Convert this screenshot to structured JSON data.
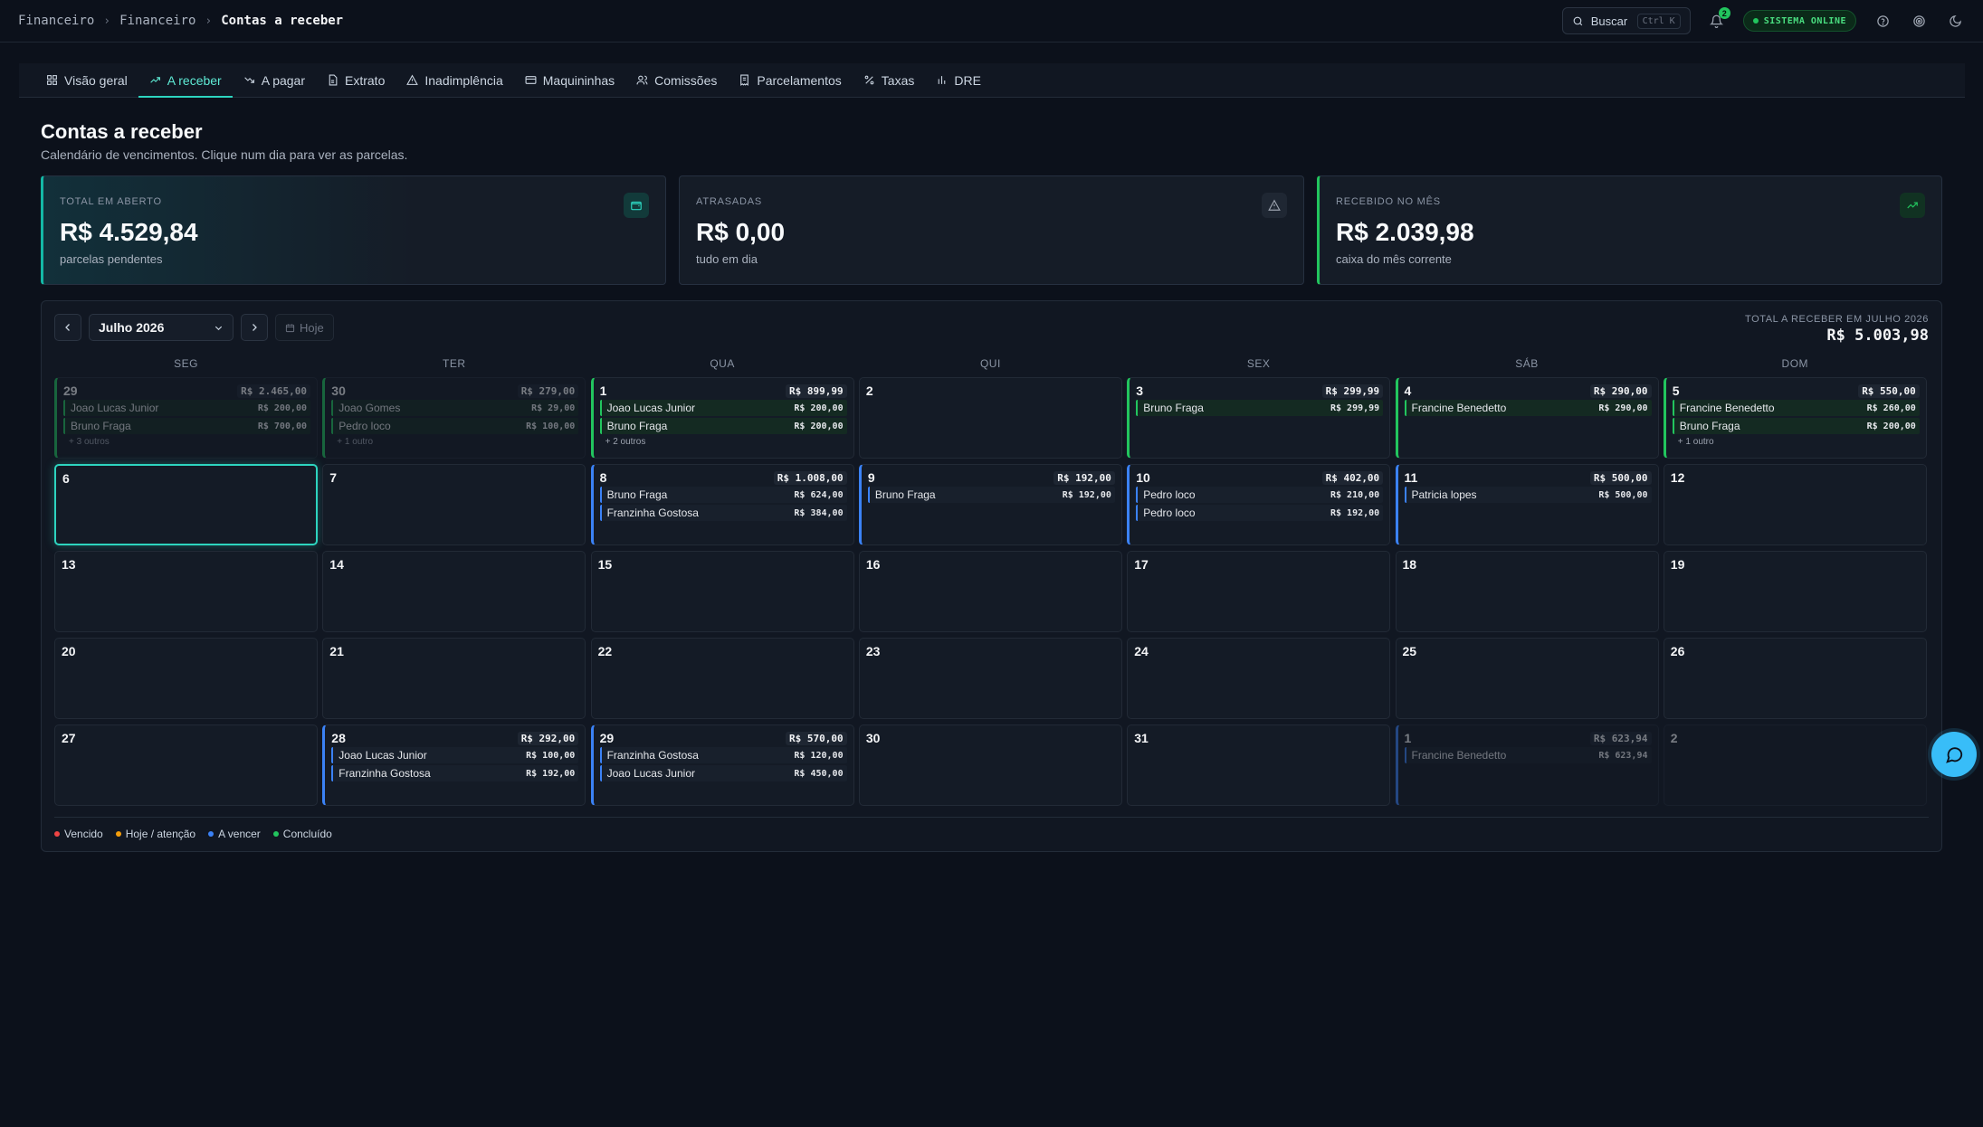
{
  "breadcrumb": [
    "Financeiro",
    "Financeiro",
    "Contas a receber"
  ],
  "header": {
    "search_label": "Buscar",
    "search_kbd": "Ctrl K",
    "notifications_count": "2",
    "status": "SISTEMA ONLINE"
  },
  "tabs": [
    {
      "label": "Visão geral",
      "icon": "grid-icon"
    },
    {
      "label": "A receber",
      "icon": "trending-up-icon",
      "active": true
    },
    {
      "label": "A pagar",
      "icon": "trending-down-icon"
    },
    {
      "label": "Extrato",
      "icon": "file-icon"
    },
    {
      "label": "Inadimplência",
      "icon": "warning-icon"
    },
    {
      "label": "Maquininhas",
      "icon": "card-icon"
    },
    {
      "label": "Comissões",
      "icon": "users-icon"
    },
    {
      "label": "Parcelamentos",
      "icon": "receipt-icon"
    },
    {
      "label": "Taxas",
      "icon": "percent-icon"
    },
    {
      "label": "DRE",
      "icon": "bar-chart-icon"
    }
  ],
  "page": {
    "title": "Contas a receber",
    "subtitle": "Calendário de vencimentos. Clique num dia para ver as parcelas."
  },
  "cards": [
    {
      "label": "TOTAL EM ABERTO",
      "value": "R$ 4.529,84",
      "sub": "parcelas pendentes",
      "icon": "wallet-icon",
      "accent": "#14b8a6"
    },
    {
      "label": "ATRASADAS",
      "value": "R$ 0,00",
      "sub": "tudo em dia",
      "icon": "warning-icon",
      "accent": "#374151"
    },
    {
      "label": "RECEBIDO NO MÊS",
      "value": "R$ 2.039,98",
      "sub": "caixa do mês corrente",
      "icon": "trending-up-icon",
      "accent": "#22c55e"
    }
  ],
  "calendar": {
    "month": "Julho 2026",
    "today_label": "Hoje",
    "total_label": "TOTAL A RECEBER EM JULHO 2026",
    "total_value": "R$ 5.003,98",
    "weekdays": [
      "SEG",
      "TER",
      "QUA",
      "QUI",
      "SEX",
      "SÁB",
      "DOM"
    ],
    "days": [
      {
        "n": "29",
        "other": true,
        "status": "green",
        "sum": "R$ 2.465,00",
        "entries": [
          {
            "name": "Joao Lucas Junior",
            "amt": "R$ 200,00",
            "g": true
          },
          {
            "name": "Bruno Fraga",
            "amt": "R$ 700,00",
            "g": true
          }
        ],
        "more": "+ 3 outros"
      },
      {
        "n": "30",
        "other": true,
        "status": "green",
        "sum": "R$ 279,00",
        "entries": [
          {
            "name": "Joao Gomes",
            "amt": "R$ 29,00",
            "g": true
          },
          {
            "name": "Pedro loco",
            "amt": "R$ 100,00",
            "g": true
          }
        ],
        "more": "+ 1 outro"
      },
      {
        "n": "1",
        "status": "green",
        "sum": "R$ 899,99",
        "entries": [
          {
            "name": "Joao Lucas Junior",
            "amt": "R$ 200,00",
            "g": true
          },
          {
            "name": "Bruno Fraga",
            "amt": "R$ 200,00",
            "g": true
          }
        ],
        "more": "+ 2 outros"
      },
      {
        "n": "2",
        "entries": []
      },
      {
        "n": "3",
        "status": "green",
        "sum": "R$ 299,99",
        "entries": [
          {
            "name": "Bruno Fraga",
            "amt": "R$ 299,99",
            "g": true
          }
        ]
      },
      {
        "n": "4",
        "status": "green",
        "sum": "R$ 290,00",
        "entries": [
          {
            "name": "Francine Benedetto",
            "amt": "R$ 290,00",
            "g": true
          }
        ]
      },
      {
        "n": "5",
        "status": "green",
        "sum": "R$ 550,00",
        "entries": [
          {
            "name": "Francine Benedetto",
            "amt": "R$ 260,00",
            "g": true
          },
          {
            "name": "Bruno Fraga",
            "amt": "R$ 200,00",
            "g": true
          }
        ],
        "more": "+ 1 outro"
      },
      {
        "n": "6",
        "today": true,
        "entries": []
      },
      {
        "n": "7",
        "entries": []
      },
      {
        "n": "8",
        "status": "blue",
        "sum": "R$ 1.008,00",
        "entries": [
          {
            "name": "Bruno Fraga",
            "amt": "R$ 624,00"
          },
          {
            "name": "Franzinha Gostosa",
            "amt": "R$ 384,00"
          }
        ]
      },
      {
        "n": "9",
        "status": "blue",
        "sum": "R$ 192,00",
        "entries": [
          {
            "name": "Bruno Fraga",
            "amt": "R$ 192,00"
          }
        ]
      },
      {
        "n": "10",
        "status": "blue",
        "sum": "R$ 402,00",
        "entries": [
          {
            "name": "Pedro loco",
            "amt": "R$ 210,00"
          },
          {
            "name": "Pedro loco",
            "amt": "R$ 192,00"
          }
        ]
      },
      {
        "n": "11",
        "status": "blue",
        "sum": "R$ 500,00",
        "entries": [
          {
            "name": "Patricia lopes",
            "amt": "R$ 500,00"
          }
        ]
      },
      {
        "n": "12",
        "entries": []
      },
      {
        "n": "13",
        "entries": []
      },
      {
        "n": "14",
        "entries": []
      },
      {
        "n": "15",
        "entries": []
      },
      {
        "n": "16",
        "entries": []
      },
      {
        "n": "17",
        "entries": []
      },
      {
        "n": "18",
        "entries": []
      },
      {
        "n": "19",
        "entries": []
      },
      {
        "n": "20",
        "entries": []
      },
      {
        "n": "21",
        "entries": []
      },
      {
        "n": "22",
        "entries": []
      },
      {
        "n": "23",
        "entries": []
      },
      {
        "n": "24",
        "entries": []
      },
      {
        "n": "25",
        "entries": []
      },
      {
        "n": "26",
        "entries": []
      },
      {
        "n": "27",
        "entries": []
      },
      {
        "n": "28",
        "status": "blue",
        "sum": "R$ 292,00",
        "entries": [
          {
            "name": "Joao Lucas Junior",
            "amt": "R$ 100,00"
          },
          {
            "name": "Franzinha Gostosa",
            "amt": "R$ 192,00"
          }
        ]
      },
      {
        "n": "29",
        "status": "blue",
        "sum": "R$ 570,00",
        "entries": [
          {
            "name": "Franzinha Gostosa",
            "amt": "R$ 120,00"
          },
          {
            "name": "Joao Lucas Junior",
            "amt": "R$ 450,00"
          }
        ]
      },
      {
        "n": "30",
        "entries": []
      },
      {
        "n": "31",
        "entries": []
      },
      {
        "n": "1",
        "other": true,
        "status": "blue",
        "sum": "R$ 623,94",
        "entries": [
          {
            "name": "Francine Benedetto",
            "amt": "R$ 623,94"
          }
        ]
      },
      {
        "n": "2",
        "other": true,
        "entries": []
      }
    ]
  },
  "legend": [
    {
      "label": "Vencido",
      "color": "#ef4444"
    },
    {
      "label": "Hoje / atenção",
      "color": "#f59e0b"
    },
    {
      "label": "A vencer",
      "color": "#3b82f6"
    },
    {
      "label": "Concluído",
      "color": "#22c55e"
    }
  ]
}
